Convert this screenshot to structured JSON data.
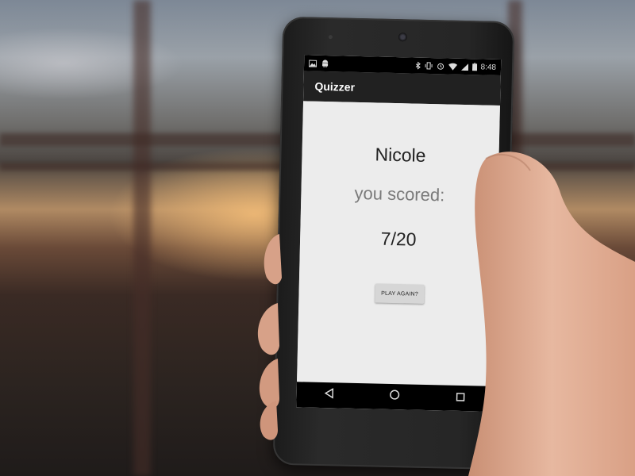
{
  "app": {
    "title": "Quizzer"
  },
  "status_bar": {
    "time": "8:48",
    "left_icons": [
      "image-icon",
      "android-icon"
    ],
    "right_icons": [
      "bluetooth-icon",
      "vibrate-icon",
      "alarm-icon",
      "wifi-icon",
      "signal-icon",
      "battery-icon"
    ]
  },
  "result": {
    "player_name": "Nicole",
    "scored_label": "you scored:",
    "score": "7/20"
  },
  "actions": {
    "play_again_label": "PLAY AGAIN?"
  },
  "nav": {
    "icons": [
      "back-icon",
      "home-icon",
      "recents-icon"
    ]
  },
  "colors": {
    "app_bar": "#212121",
    "status_bar": "#000000",
    "screen_background": "#ececec",
    "button_background": "#d6d6d6"
  }
}
